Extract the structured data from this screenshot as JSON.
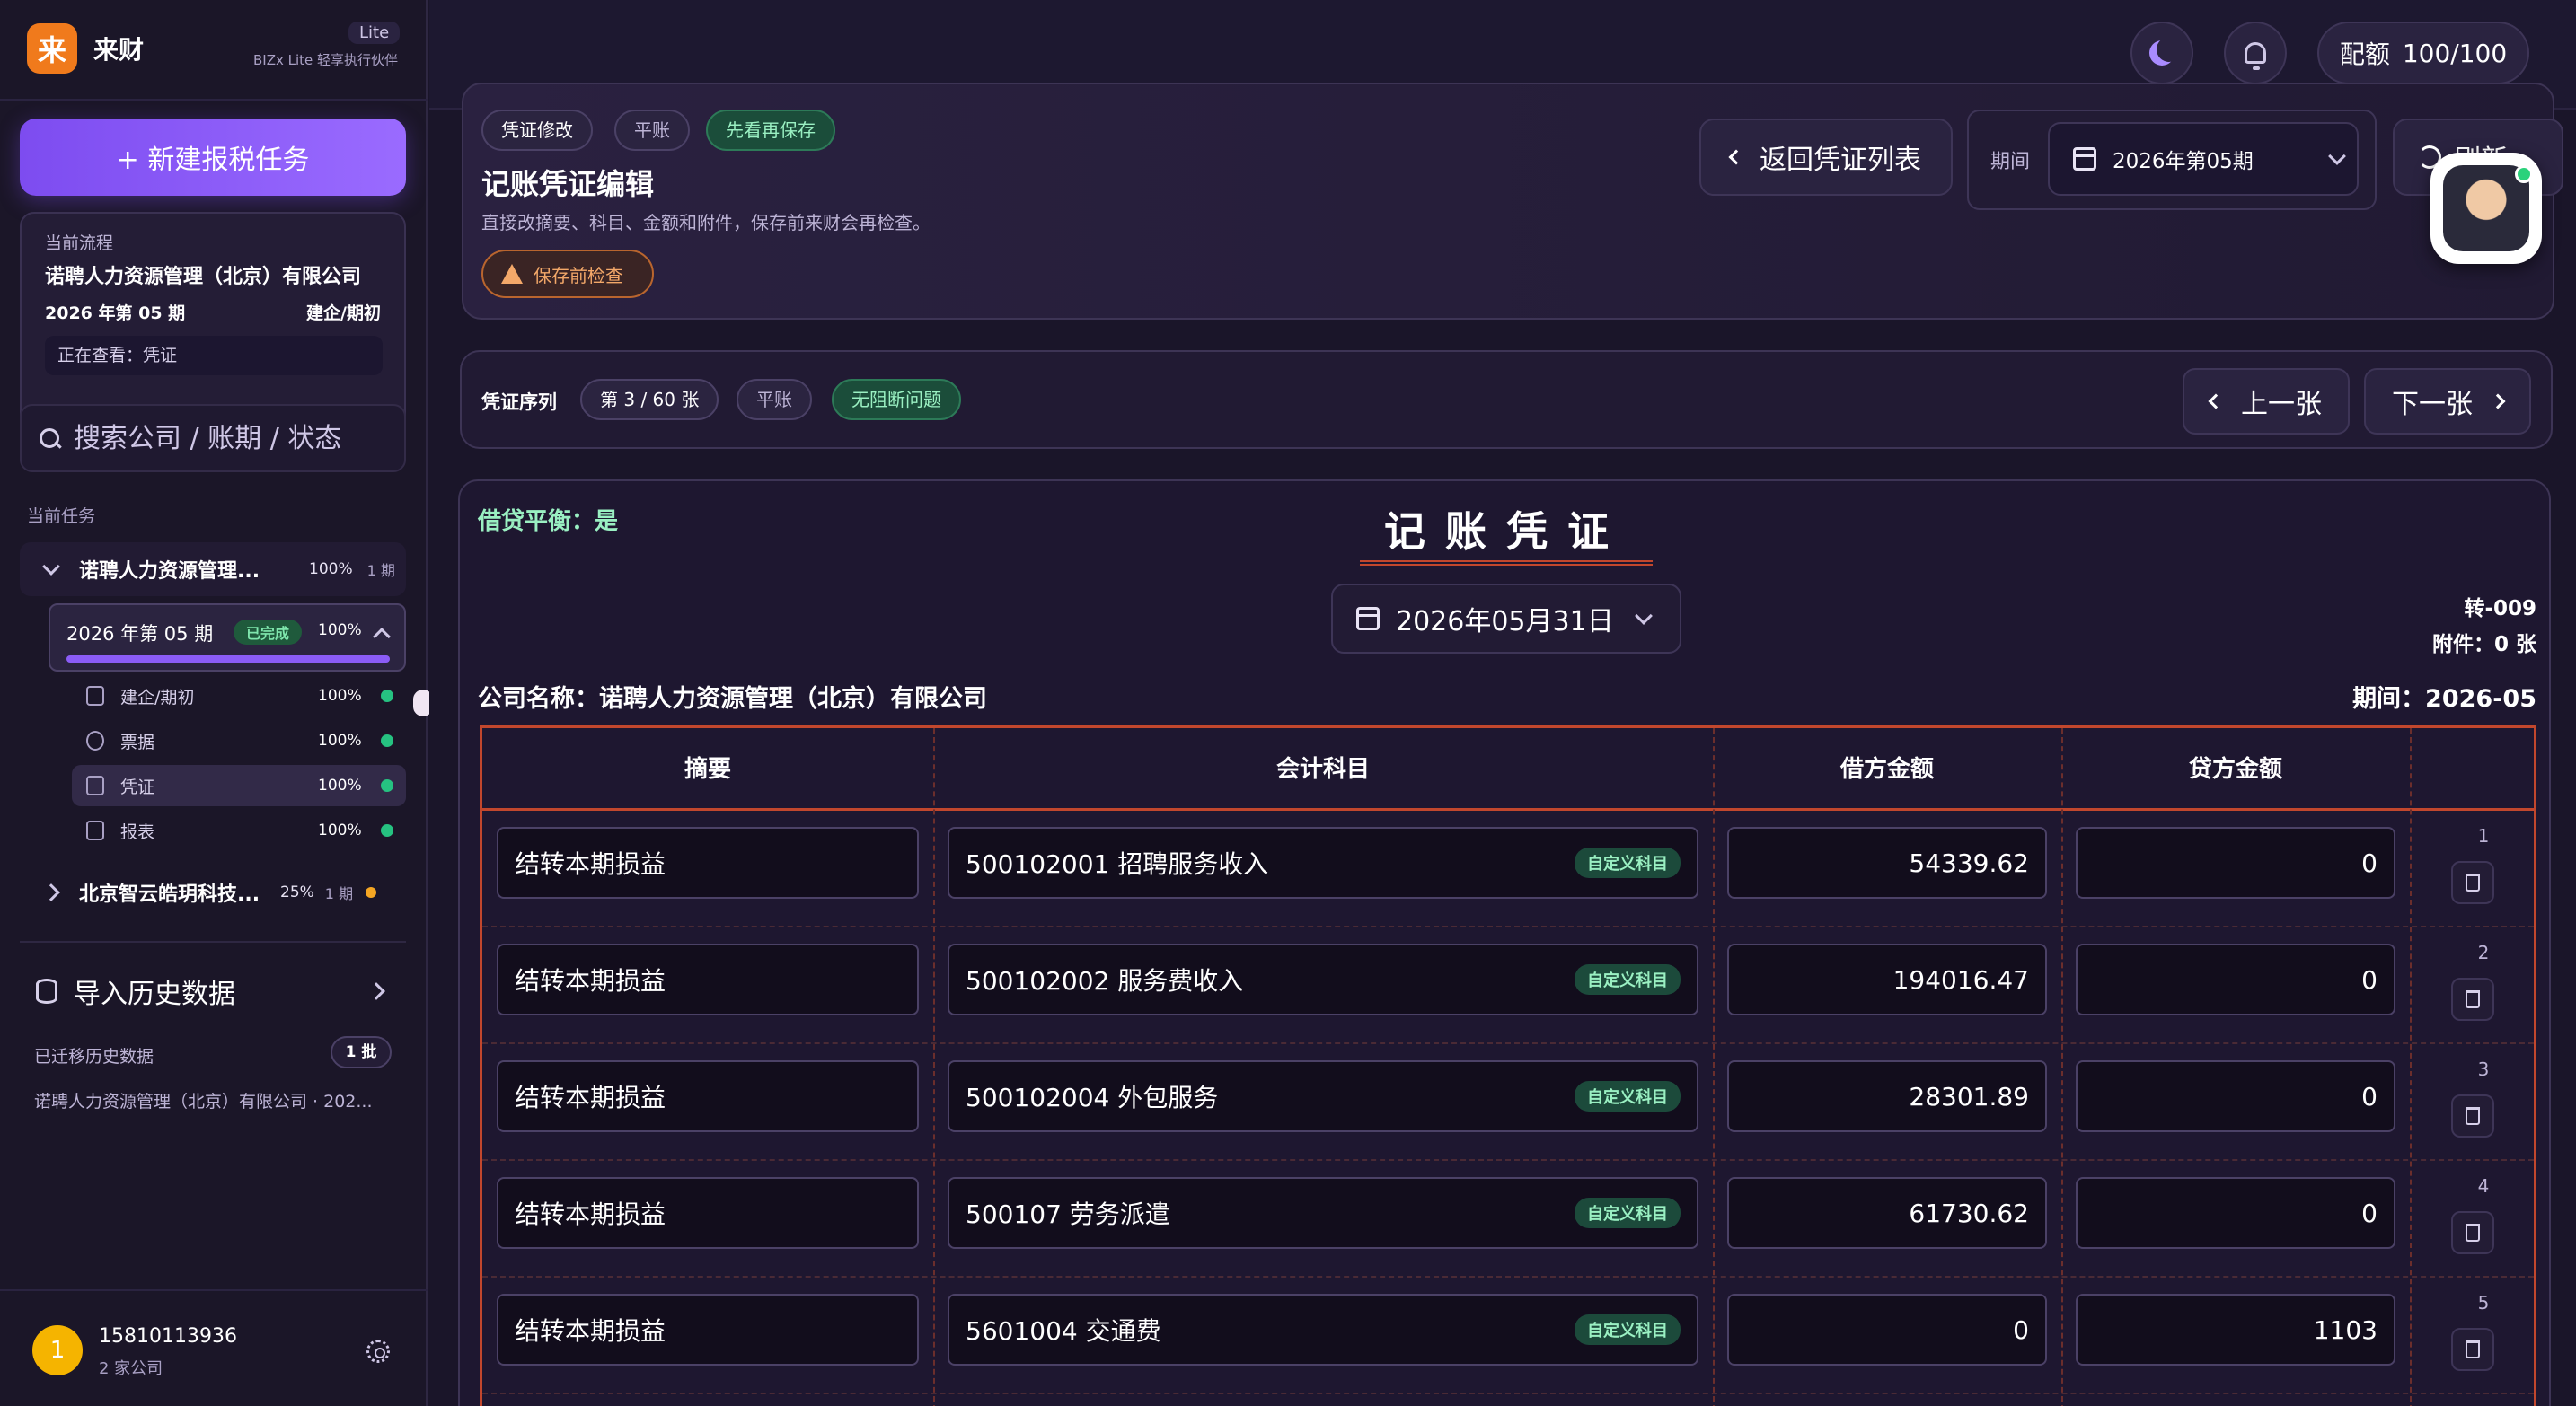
{
  "brand": {
    "logo_char": "来",
    "name": "来财",
    "edition": "Lite",
    "tagline": "BIZx Lite 轻享执行伙伴"
  },
  "sidebar": {
    "new_task_label": "+  新建报税任务",
    "flow": {
      "label": "当前流程",
      "company": "诺聘人力资源管理（北京）有限公司",
      "period": "2026 年第 05 期",
      "phase": "建企/期初",
      "viewing": "正在查看：凭证"
    },
    "search_placeholder": "搜索公司 / 账期 / 状态",
    "current_tasks_label": "当前任务",
    "company1": {
      "name": "诺聘人力资源管理...",
      "pct": "100%",
      "periods": "1 期"
    },
    "period_card": {
      "title": "2026 年第 05 期",
      "badge": "已完成",
      "pct": "100%",
      "progress": 1.0
    },
    "steps": [
      {
        "label": "建企/期初",
        "pct": "100%",
        "icon": "building-icon"
      },
      {
        "label": "票据",
        "pct": "100%",
        "icon": "cloud-icon"
      },
      {
        "label": "凭证",
        "pct": "100%",
        "icon": "voucher-icon"
      },
      {
        "label": "报表",
        "pct": "100%",
        "icon": "report-icon"
      }
    ],
    "company2": {
      "name": "北京智云皓玥科技...",
      "pct": "25%",
      "periods": "1 期"
    },
    "import_label": "导入历史数据",
    "history_label": "已迁移历史数据",
    "history_badge": "1 批",
    "history_item": "诺聘人力资源管理（北京）有限公司 · 202...",
    "user": {
      "avatar_char": "1",
      "phone": "15810113936",
      "sub": "2 家公司"
    }
  },
  "topbar": {
    "quota_label": "配额",
    "quota_value": "100/100"
  },
  "editor": {
    "pills": [
      "凭证修改",
      "平账",
      "先看再保存"
    ],
    "title": "记账凭证编辑",
    "subtitle": "直接改摘要、科目、金额和附件，保存前来财会再检查。",
    "warn_label": "保存前检查",
    "back_label": "返回凭证列表",
    "period_label": "期间",
    "period_value": "2026年第05期",
    "refresh_label": "刷新"
  },
  "sequence": {
    "label": "凭证序列",
    "position": "第 3 / 60 张",
    "status": "平账",
    "issues": "无阻断问题",
    "prev_label": "上一张",
    "next_label": "下一张"
  },
  "voucher": {
    "balance": "借贷平衡：是",
    "title": "记账凭证",
    "date": "2026年05月31日",
    "number": "转-009",
    "attachments": "附件：0 张",
    "company": "公司名称：诺聘人力资源管理（北京）有限公司",
    "period": "期间：2026-05",
    "columns": [
      "摘要",
      "会计科目",
      "借方金额",
      "贷方金额"
    ],
    "rows": [
      {
        "no": "1",
        "summary": "结转本期损益",
        "account": "500102001 招聘服务收入",
        "tag": "自定义科目",
        "debit": "54339.62",
        "credit": "0"
      },
      {
        "no": "2",
        "summary": "结转本期损益",
        "account": "500102002 服务费收入",
        "tag": "自定义科目",
        "debit": "194016.47",
        "credit": "0"
      },
      {
        "no": "3",
        "summary": "结转本期损益",
        "account": "500102004 外包服务",
        "tag": "自定义科目",
        "debit": "28301.89",
        "credit": "0"
      },
      {
        "no": "4",
        "summary": "结转本期损益",
        "account": "500107 劳务派遣",
        "tag": "自定义科目",
        "debit": "61730.62",
        "credit": "0"
      },
      {
        "no": "5",
        "summary": "结转本期损益",
        "account": "5601004 交通费",
        "tag": "自定义科目",
        "debit": "0",
        "credit": "1103"
      }
    ]
  }
}
